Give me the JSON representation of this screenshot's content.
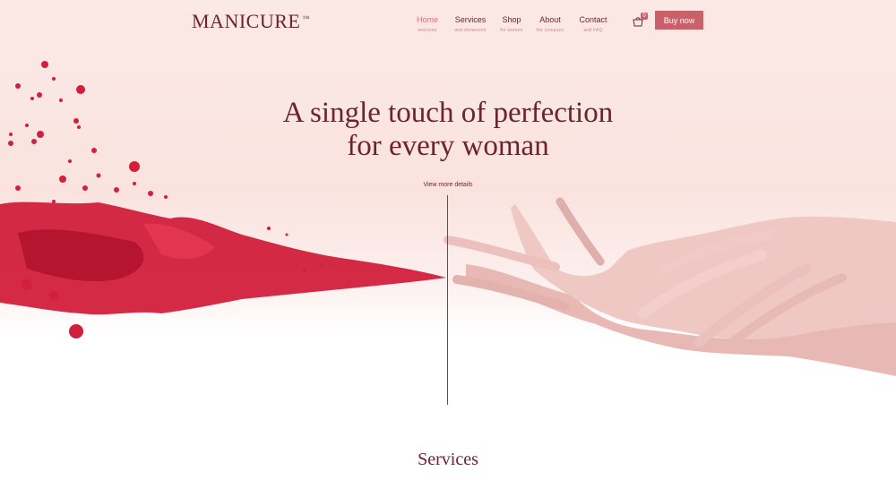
{
  "header": {
    "logo": "MANICURE",
    "logo_mark": "™",
    "nav": [
      {
        "label": "Home",
        "sub": "welcome"
      },
      {
        "label": "Services",
        "sub": "and showroom"
      },
      {
        "label": "Shop",
        "sub": "for women"
      },
      {
        "label": "About",
        "sub": "the company"
      },
      {
        "label": "Contact",
        "sub": "and FAQ"
      }
    ],
    "cart_count": "0",
    "buy_label": "Buy now"
  },
  "hero": {
    "title_line1": "A single touch of perfection",
    "title_line2": "for every woman",
    "details_link": "View more details"
  },
  "sections": {
    "services_title": "Services"
  },
  "colors": {
    "accent": "#c9616b",
    "text_primary": "#6b2330",
    "splash": "#d21f3c"
  }
}
